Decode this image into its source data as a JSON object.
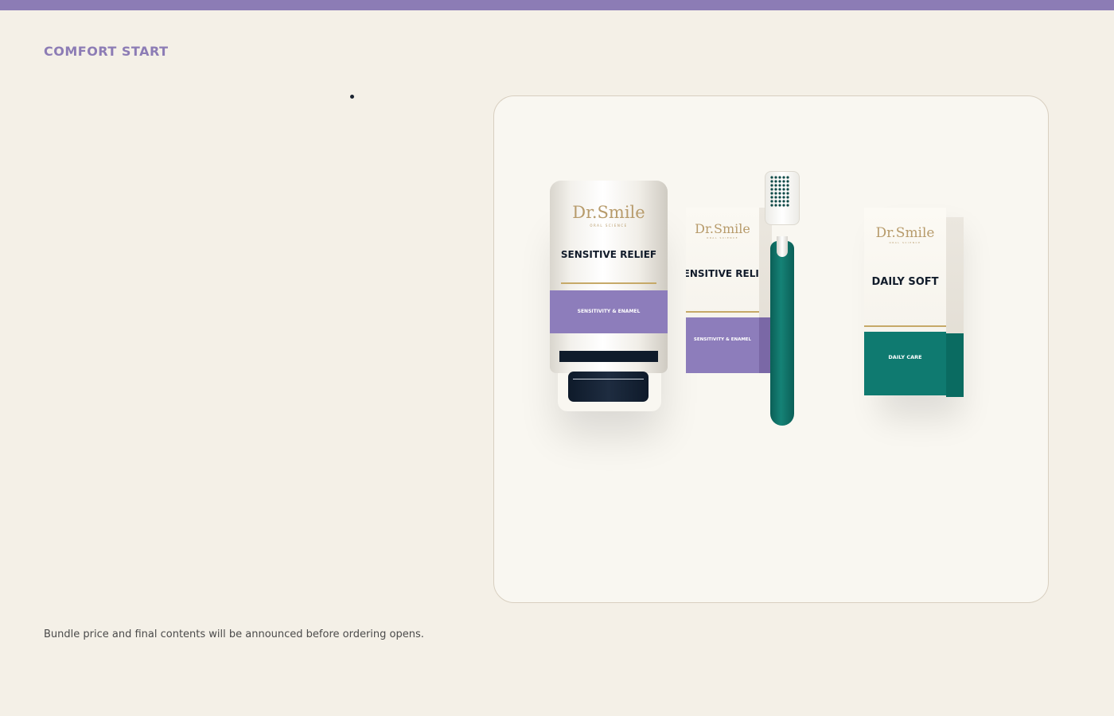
{
  "header": {
    "eyebrow": "COMFORT START"
  },
  "footer": {
    "note": "Bundle price and final contents will be announced before ordering opens."
  },
  "products": {
    "tube": {
      "brand": "Dr.Smile",
      "brand_sub": "ORAL SCIENCE",
      "title": "SENSITIVE RELIEF",
      "band": "SENSITIVITY & ENAMEL"
    },
    "box_small": {
      "brand": "Dr.Smile",
      "brand_sub": "ORAL SCIENCE",
      "title": "SENSITIVE RELIEF",
      "band": "SENSITIVITY & ENAMEL"
    },
    "box_daily": {
      "brand": "Dr.Smile",
      "brand_sub": "ORAL SCIENCE",
      "title": "DAILY SOFT",
      "band": "DAILY CARE"
    }
  },
  "colors": {
    "accent": "#8c7cb5",
    "teal": "#0f7a70",
    "navy": "#0f1b2b",
    "gold": "#c6a968",
    "background": "#f4f0e7"
  }
}
